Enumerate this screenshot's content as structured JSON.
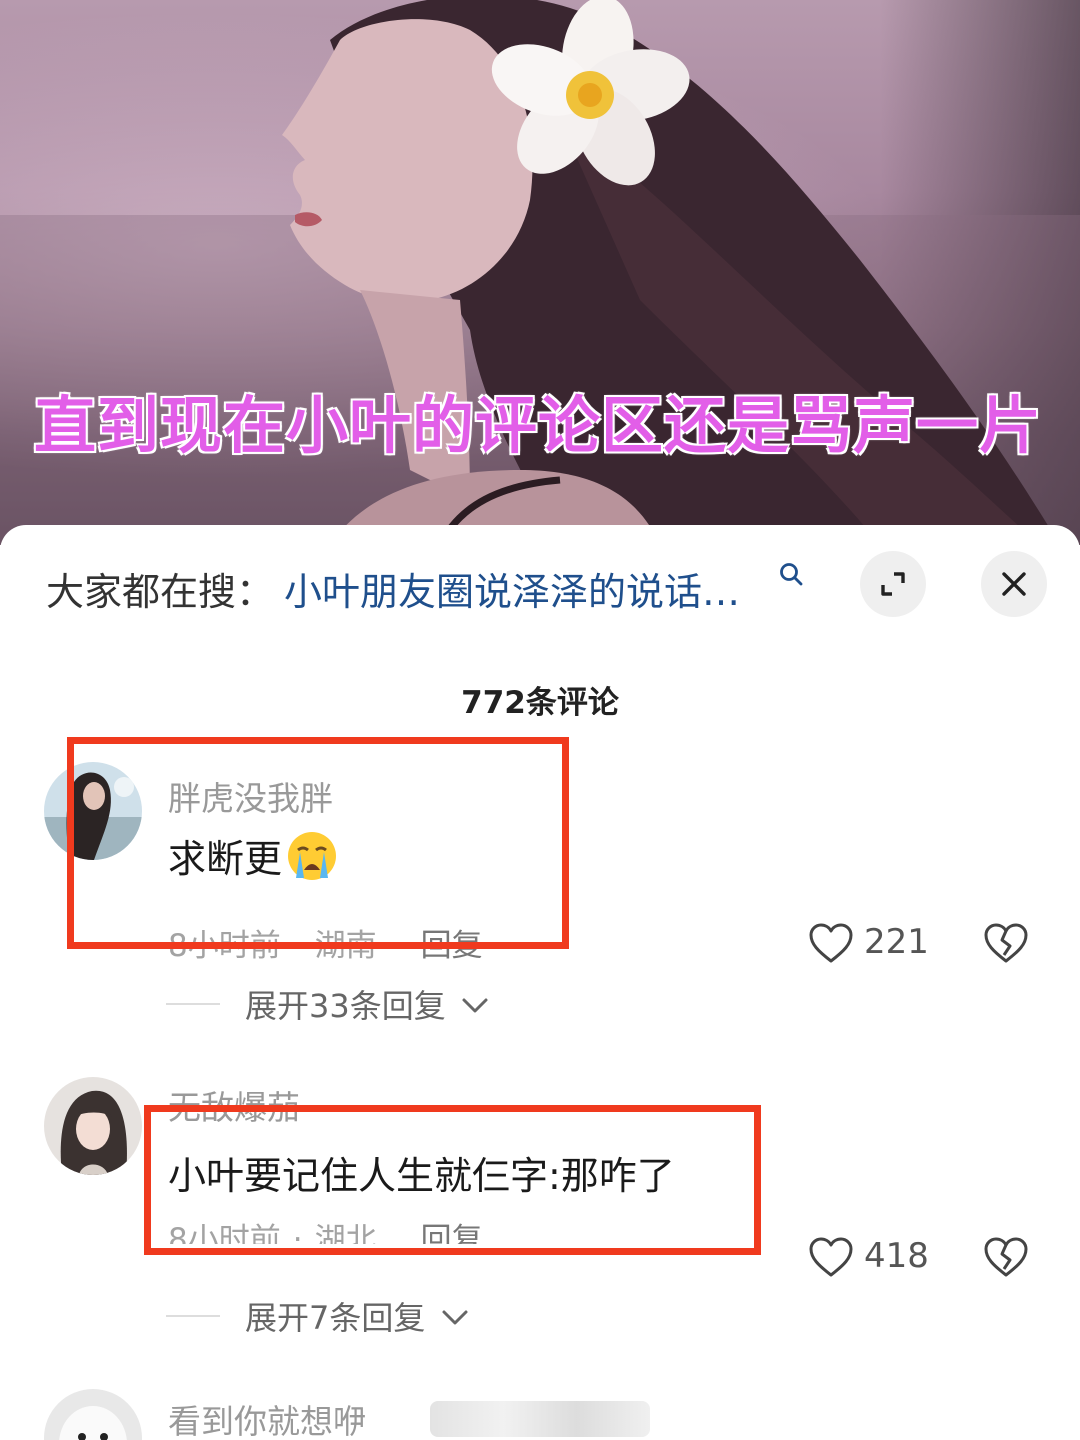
{
  "video": {
    "caption": "直到现在小叶的评论区还是骂声一片"
  },
  "search": {
    "prefix": "大家都在搜：",
    "query": "小叶朋友圈说泽泽的说话…"
  },
  "comments_header": {
    "count_label": "772条评论"
  },
  "comments": [
    {
      "username": "胖虎没我胖",
      "text": "求断更",
      "emoji": "loudly-crying-face",
      "time": "8小时前",
      "location": "湖南",
      "reply_label": "回复",
      "likes": "221",
      "expand_label": "展开33条回复"
    },
    {
      "username": "无敌爆茄",
      "text": "小叶要记住人生就仨字:那咋了",
      "time": "8小时前",
      "location": "湖北",
      "reply_label": "回复",
      "likes": "418",
      "expand_label": "展开7条回复"
    },
    {
      "username": "看到你就想咿"
    }
  ],
  "colors": {
    "caption": "#e25ee8",
    "search_link": "#1f4f8c",
    "highlight_box": "#f03a1e"
  }
}
